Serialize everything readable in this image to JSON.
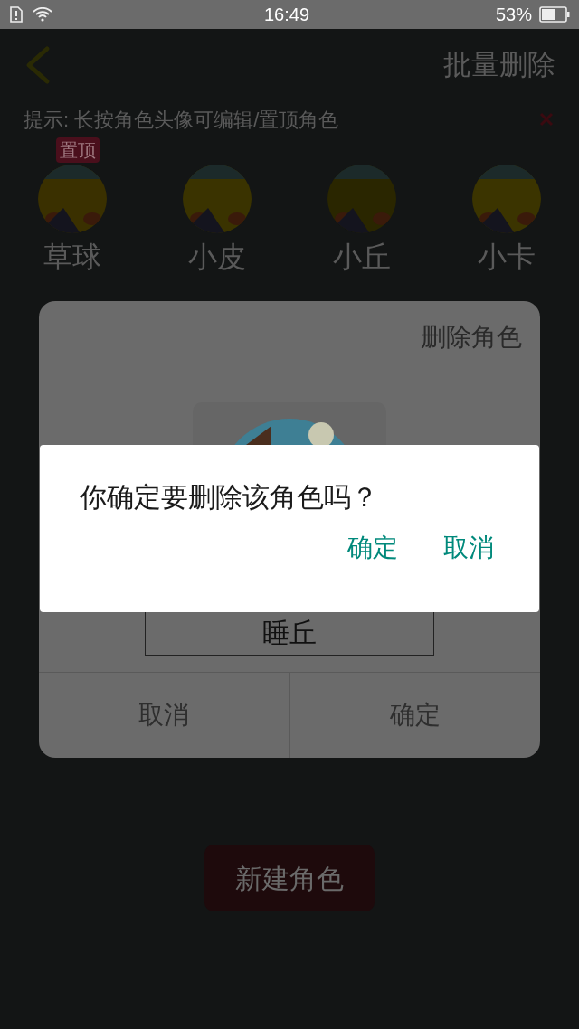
{
  "status_bar": {
    "time": "16:49",
    "battery": "53%"
  },
  "header": {
    "action": "批量删除"
  },
  "tip": {
    "text": "提示: 长按角色头像可编辑/置顶角色"
  },
  "characters": [
    {
      "name": "草球",
      "badge": "置顶",
      "color": "#3a3000"
    },
    {
      "name": "小皮",
      "color": "#3a3300"
    },
    {
      "name": "小丘",
      "color": "#2a2600"
    },
    {
      "name": "小卡",
      "color": "#3b3400"
    }
  ],
  "new_button": "新建角色",
  "edit_dialog": {
    "title": "删除角色",
    "name_value": "睡丘",
    "buttons": [
      "取消",
      "确定"
    ]
  },
  "confirm_dialog": {
    "message": "你确定要删除该角色吗？",
    "buttons": [
      "确定",
      "取消"
    ]
  }
}
